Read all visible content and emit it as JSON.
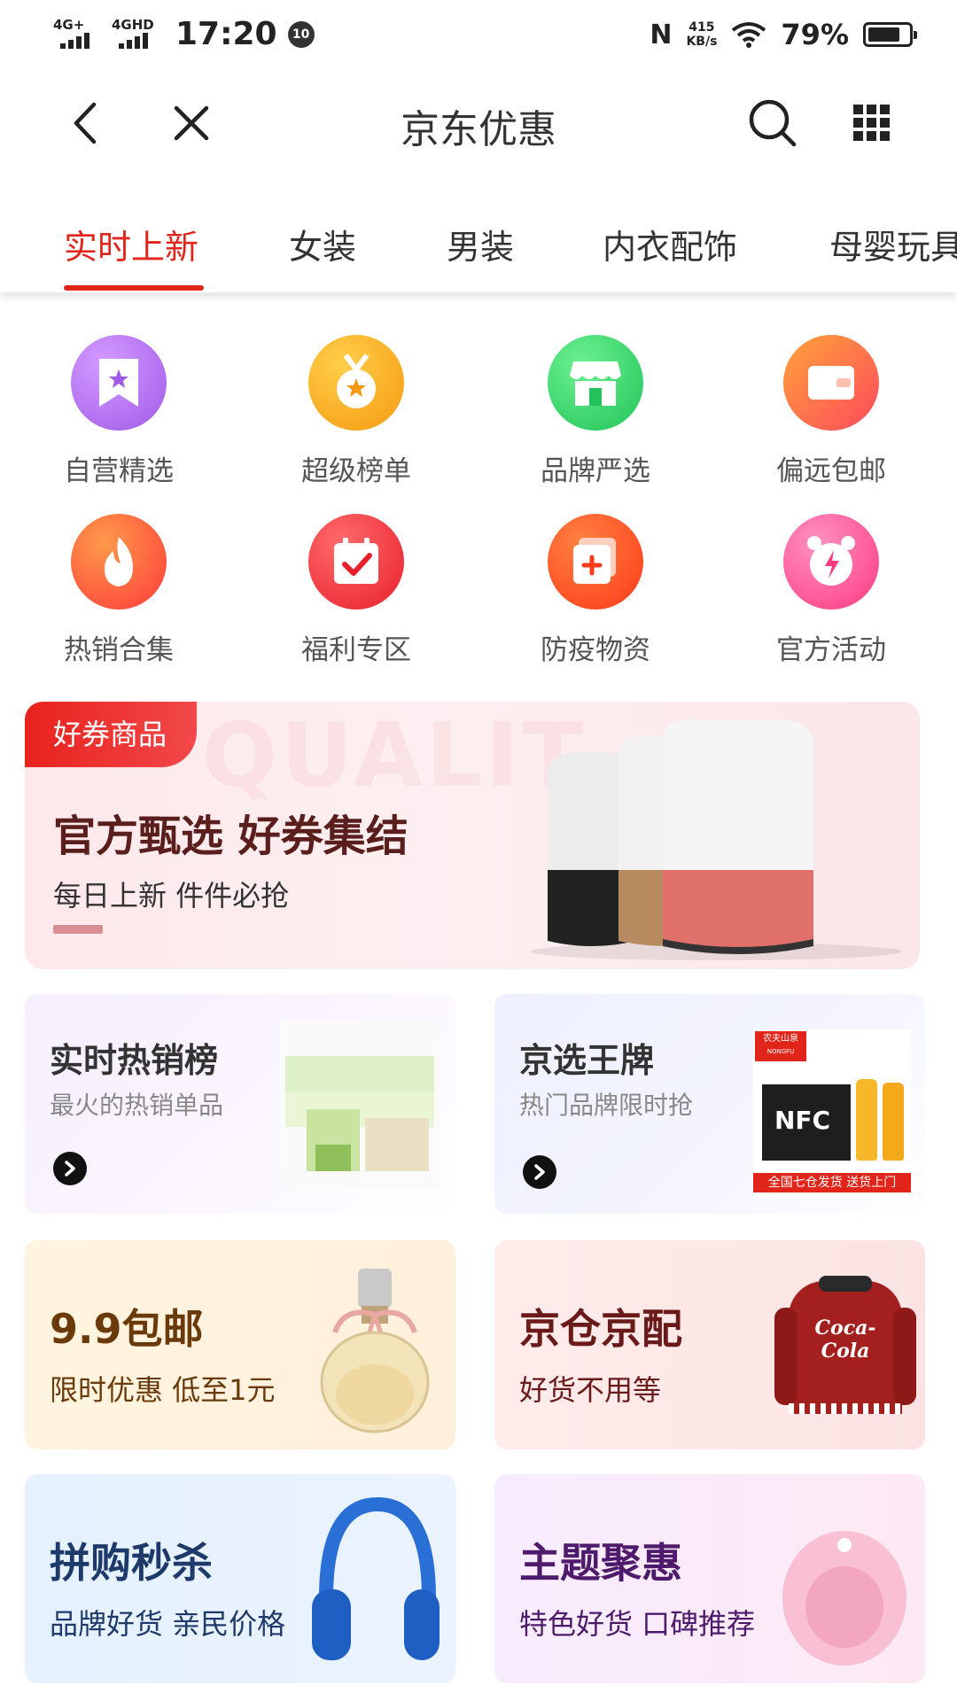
{
  "status_bar": {
    "net1": "4G+",
    "net2": "4GHD",
    "time": "17:20",
    "badge": "10",
    "nfc": "N",
    "speed_value": "415",
    "speed_unit": "KB/s",
    "battery_percent": "79%",
    "battery_level": 0.79
  },
  "navbar": {
    "title": "京东优惠",
    "icons": [
      "back-icon",
      "close-icon",
      "search-icon",
      "grid-menu-icon"
    ]
  },
  "tabs": [
    {
      "label": "实时上新",
      "active": true
    },
    {
      "label": "女装",
      "active": false
    },
    {
      "label": "男装",
      "active": false
    },
    {
      "label": "内衣配饰",
      "active": false
    },
    {
      "label": "母婴玩具",
      "active": false
    }
  ],
  "categories": [
    {
      "label": "自营精选",
      "icon": "bookmark-star-icon",
      "color": "#b46cf0"
    },
    {
      "label": "超级榜单",
      "icon": "medal-icon",
      "color": "#f7a51d"
    },
    {
      "label": "品牌严选",
      "icon": "store-icon",
      "color": "#2fd16b"
    },
    {
      "label": "偏远包邮",
      "icon": "wallet-icon",
      "color": "#ff7a3a"
    },
    {
      "label": "热销合集",
      "icon": "flame-icon",
      "color": "#ff5a3a"
    },
    {
      "label": "福利专区",
      "icon": "calendar-check-icon",
      "color": "#f0363e"
    },
    {
      "label": "防疫物资",
      "icon": "medical-kit-icon",
      "color": "#ff4a2a"
    },
    {
      "label": "官方活动",
      "icon": "alarm-clock-icon",
      "color": "#ff5c9a"
    }
  ],
  "banner": {
    "tag": "好券商品",
    "title": "官方甄选 好券集结",
    "subtitle": "每日上新 件件必抢",
    "watermark": "QUALIT"
  },
  "cards": {
    "hot": {
      "title": "实时热销榜",
      "subtitle": "最火的热销单品"
    },
    "brand": {
      "title": "京选王牌",
      "subtitle": "热门品牌限时抢",
      "product_brand": "农夫山泉",
      "product_brand_en": "NONGFU SPRING",
      "product_name": "NFC",
      "product_tag": "全国七仓发货 送货上门"
    },
    "shipping": {
      "title": "9.9包邮",
      "subtitle": "限时优惠 低至1元"
    },
    "warehouse": {
      "title": "京仓京配",
      "subtitle": "好货不用等",
      "product_logo": "Coca-Cola"
    },
    "flash": {
      "title": "拼购秒杀",
      "subtitle": "品牌好货 亲民价格"
    },
    "theme": {
      "title": "主题聚惠",
      "subtitle": "特色好货 口碑推荐"
    }
  },
  "colors": {
    "accent": "#e1251b"
  }
}
